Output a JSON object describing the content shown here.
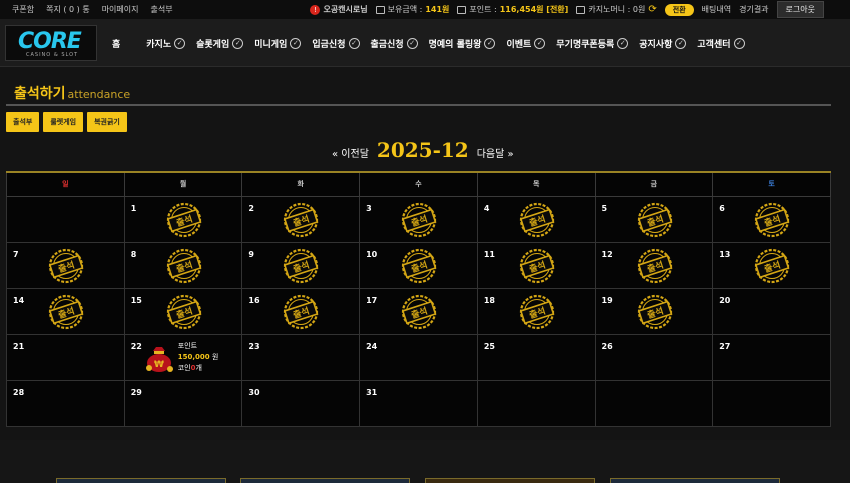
{
  "topbar": {
    "left": [
      "쿠폰함",
      "쪽지 ( 0 ) 통",
      "마이페이지",
      "출석부"
    ],
    "user_icon": "user-badge-icon",
    "username": "오공캔시로님",
    "balance_label": "보유금액 :",
    "balance_value": "141원",
    "point_label": "포인트 :",
    "point_value": "116,454원 [전환]",
    "casino_label": "카지노머니 : 0원",
    "convert_label": "전환",
    "bet_history": "배팅내역",
    "game_results": "경기결과",
    "logout": "로그아웃"
  },
  "nav": {
    "logo_text": "CORE",
    "logo_sub": "CASINO & SLOT",
    "home": "홈",
    "items": [
      "카지노",
      "슬롯게임",
      "미니게임",
      "입금신청",
      "출금신청",
      "명예의 롤링왕",
      "이벤트",
      "무기명쿠폰등록",
      "공지사항",
      "고객센터"
    ]
  },
  "page": {
    "title": "출석하기",
    "title_en": "attendance",
    "buttons": [
      "출석부",
      "룰렛게임",
      "복권긁기"
    ]
  },
  "calendar": {
    "prev": "« 이전달",
    "month": "2025-12",
    "next": "다음달 »",
    "weekdays": [
      "일",
      "월",
      "화",
      "수",
      "목",
      "금",
      "토"
    ],
    "stamp_label": "출석",
    "weeks": [
      [
        null,
        1,
        2,
        3,
        4,
        5,
        6
      ],
      [
        7,
        8,
        9,
        10,
        11,
        12,
        13
      ],
      [
        14,
        15,
        16,
        17,
        18,
        19,
        20
      ],
      [
        21,
        22,
        23,
        24,
        25,
        26,
        27
      ],
      [
        28,
        29,
        30,
        31,
        null,
        null,
        null
      ]
    ],
    "attended": [
      1,
      2,
      3,
      4,
      5,
      6,
      7,
      8,
      9,
      10,
      11,
      12,
      13,
      14,
      15,
      16,
      17,
      18,
      19
    ],
    "reward_day": 22,
    "reward": {
      "label": "포인트",
      "points": "150,000",
      "points_unit": "원",
      "coin_label": "코인",
      "coin_value": "0",
      "coin_unit": "개"
    }
  },
  "colors": {
    "accent": "#f5c518",
    "sunday": "#e03030",
    "saturday": "#3a7bd5",
    "logo": "#29c7ee"
  }
}
